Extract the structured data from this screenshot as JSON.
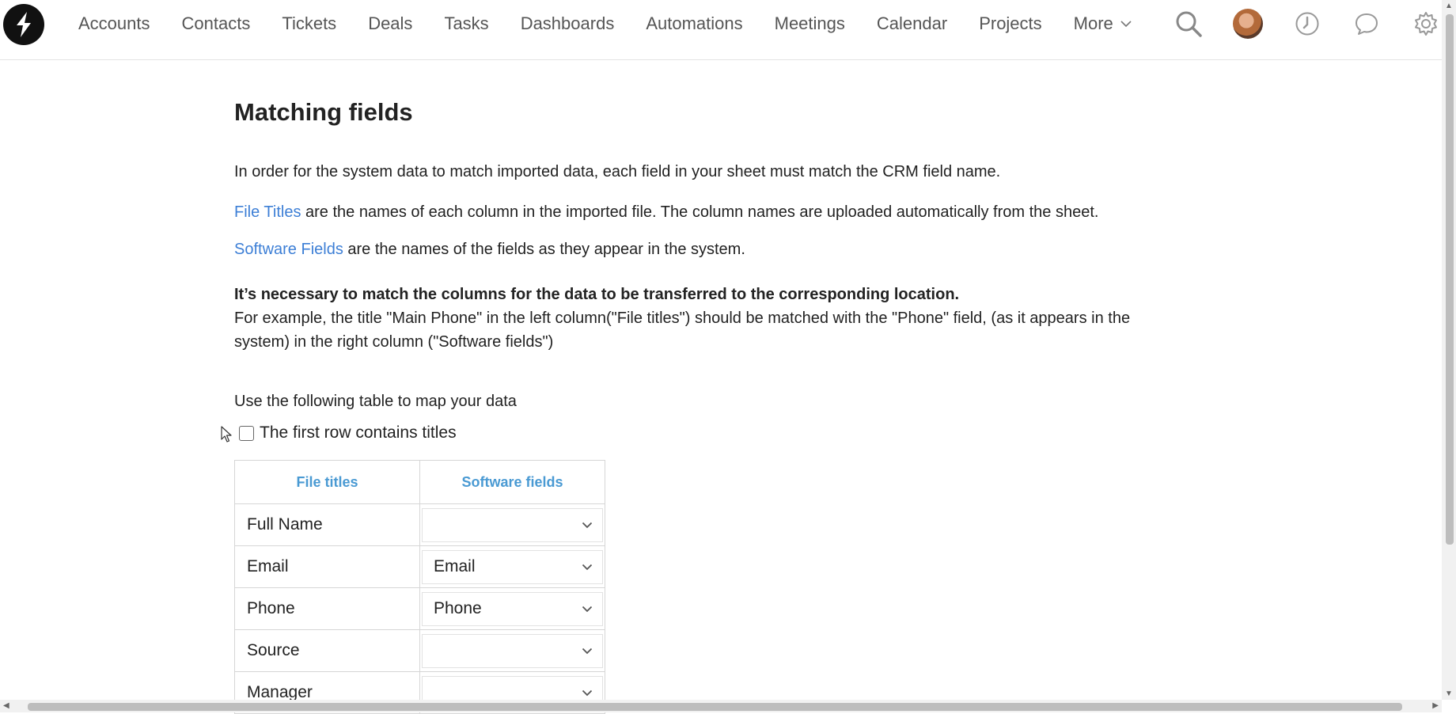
{
  "nav": {
    "items": [
      "Accounts",
      "Contacts",
      "Tickets",
      "Deals",
      "Tasks",
      "Dashboards",
      "Automations",
      "Meetings",
      "Calendar",
      "Projects"
    ],
    "more_label": "More",
    "icons": [
      "search-icon",
      "avatar",
      "clock-icon",
      "chat-icon",
      "gear-icon"
    ]
  },
  "page": {
    "title": "Matching fields",
    "intro": "In order for the system data to match imported data, each field in your sheet must match the CRM field name.",
    "file_titles_link": "File Titles",
    "file_titles_text": " are the names of each column in the imported file. The column names are uploaded automatically from the sheet.",
    "software_fields_link": "Software Fields",
    "software_fields_text": " are the names of the fields as they appear in the system.",
    "notice_bold": "It’s necessary to match the columns for the data to be transferred to the corresponding location.",
    "notice_example": "For example, the title \"Main Phone\" in the left column(\"File titles\") should be matched with the \"Phone\" field, (as it appears in the system) in the right column (\"Software fields\")",
    "table_intro": "Use the following table to map your data",
    "checkbox_label": "The first row contains titles",
    "checkbox_checked": false
  },
  "table": {
    "headers": [
      "File titles",
      "Software fields"
    ],
    "rows": [
      {
        "title": "Full Name",
        "field": ""
      },
      {
        "title": "Email",
        "field": "Email"
      },
      {
        "title": "Phone",
        "field": "Phone"
      },
      {
        "title": "Source",
        "field": ""
      },
      {
        "title": "Manager",
        "field": ""
      }
    ]
  },
  "colors": {
    "link": "#3d7fd6",
    "table_header": "#4a9ad3"
  }
}
